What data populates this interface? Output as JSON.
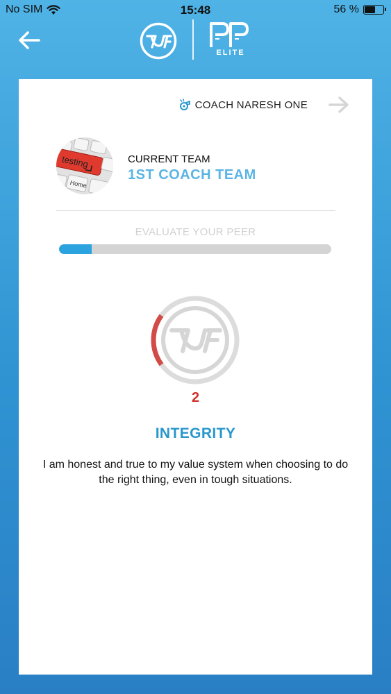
{
  "status_bar": {
    "carrier": "No SIM",
    "time": "15:48",
    "battery_percent": "56 %",
    "battery_level": 0.56
  },
  "header": {
    "back_icon": "arrow-left-icon",
    "logo_left_icon": "tsf-logo",
    "logo_right_icon": "pp-elite-logo",
    "logo_right_text": "ELITE"
  },
  "card": {
    "coach": {
      "icon": "whistle-icon",
      "name": "COACH NARESH ONE",
      "next_icon": "arrow-right-icon"
    },
    "team": {
      "label": "CURRENT TEAM",
      "name": "1ST  COACH TEAM"
    },
    "evaluation": {
      "title": "EVALUATE YOUR PEER",
      "progress": 0.12
    },
    "rating": {
      "score": "2",
      "max": 10,
      "title": "INTEGRITY",
      "description": "I am honest and true to my value system when choosing to do the right thing, even in tough situations."
    }
  },
  "colors": {
    "accent": "#2a97cc",
    "progress": "#2aa3df",
    "score": "#d0302b",
    "gauge_track": "#dcdcdc"
  }
}
